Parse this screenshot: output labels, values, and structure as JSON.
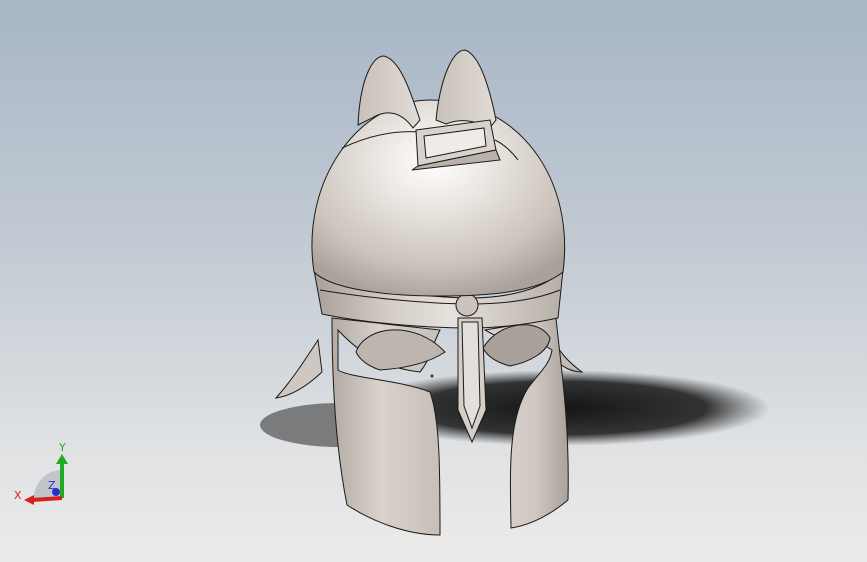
{
  "view": {
    "model": "helmet",
    "background_top": "#a8b6c6",
    "background_bottom": "#ecebe9",
    "model_color": "#d8d1cb",
    "edge_color": "#1a1a1a"
  },
  "triad": {
    "x_label": "X",
    "y_label": "Y",
    "z_label": "Z",
    "x_color": "#d62020",
    "y_color": "#22aa22",
    "z_color": "#2233cc"
  }
}
